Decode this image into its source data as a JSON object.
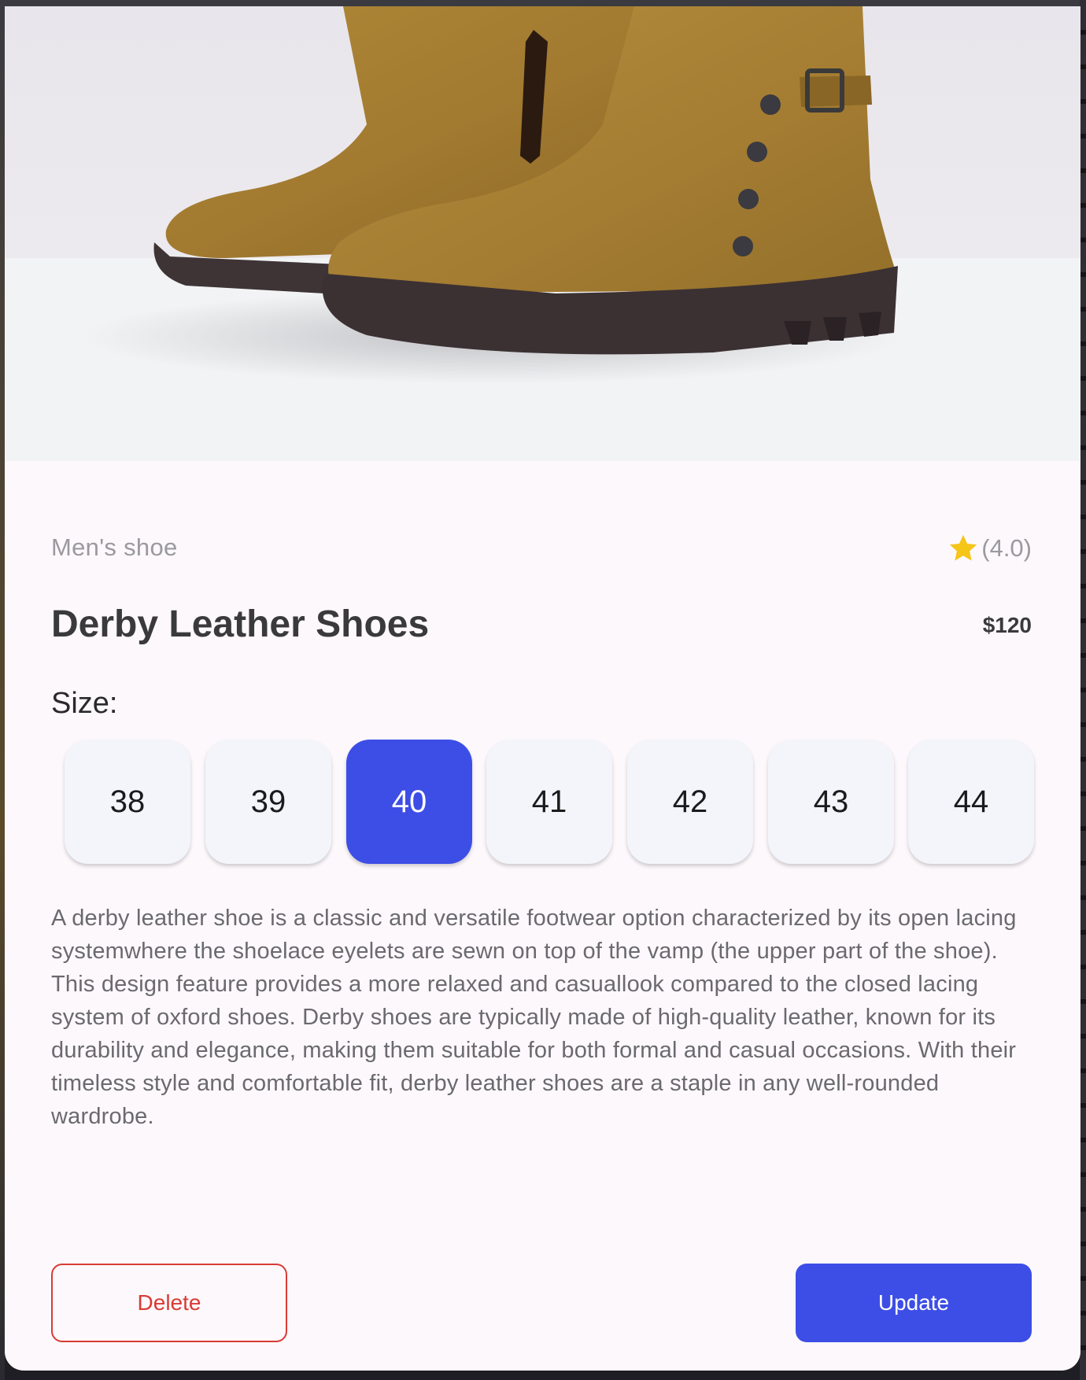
{
  "product": {
    "category": "Men's shoe",
    "rating_text": "(4.0)",
    "rating_value": 4.0,
    "title": "Derby Leather Shoes",
    "price": "$120",
    "size_label": "Size:",
    "sizes": [
      "38",
      "39",
      "40",
      "41",
      "42",
      "43",
      "44"
    ],
    "selected_size": "40",
    "description": "A derby leather shoe is a classic and versatile footwear option characterized by its open lacing systemwhere the shoelace eyelets are sewn on top of the vamp (the upper part of the shoe). This design feature provides a more relaxed and casuallook compared to the closed lacing system of oxford shoes. Derby shoes are typically made of high-quality leather, known for its durability and elegance, making them suitable for both formal and casual occasions. With their timeless style and comfortable fit, derby leather shoes are a staple in any well-rounded wardrobe."
  },
  "actions": {
    "delete_label": "Delete",
    "update_label": "Update"
  },
  "colors": {
    "accent": "#3d4ee6",
    "danger": "#d93b34",
    "star": "#f5c518",
    "background": "#fdf8fb"
  },
  "icons": {
    "rating": "star-icon"
  }
}
